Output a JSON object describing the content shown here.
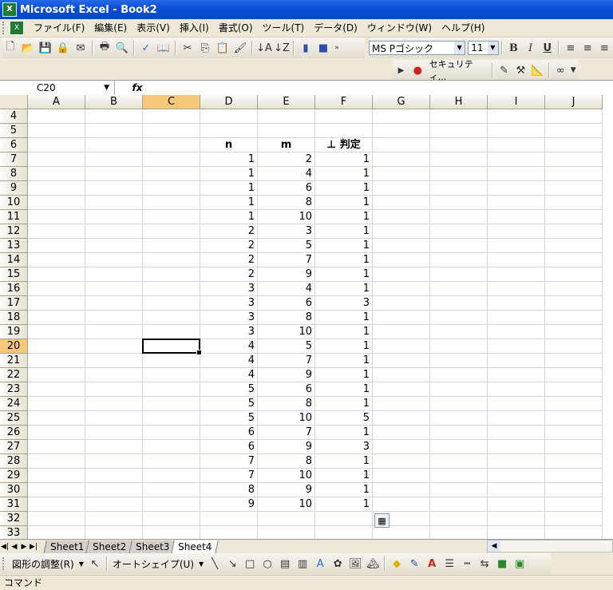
{
  "window": {
    "title": "Microsoft Excel - Book2"
  },
  "menu": [
    "ファイル(F)",
    "編集(E)",
    "表示(V)",
    "挿入(I)",
    "書式(O)",
    "ツール(T)",
    "データ(D)",
    "ウィンドウ(W)",
    "ヘルプ(H)"
  ],
  "format": {
    "font": "MS Pゴシック",
    "size": "11",
    "bold": "B",
    "italic": "I",
    "underline": "U"
  },
  "security": {
    "label": "セキュリティ..."
  },
  "formula": {
    "cell_ref": "C20",
    "fx": "fx",
    "content": ""
  },
  "columns": [
    "A",
    "B",
    "C",
    "D",
    "E",
    "F",
    "G",
    "H",
    "I",
    "J"
  ],
  "active": {
    "col": "C",
    "row": 20
  },
  "headers": {
    "n": "n",
    "m": "m",
    "f": "⊥ 判定"
  },
  "rows": [
    {
      "r": 4
    },
    {
      "r": 5
    },
    {
      "r": 6,
      "header": true
    },
    {
      "r": 7,
      "n": "1",
      "m": "2",
      "f": "1"
    },
    {
      "r": 8,
      "n": "1",
      "m": "4",
      "f": "1"
    },
    {
      "r": 9,
      "n": "1",
      "m": "6",
      "f": "1"
    },
    {
      "r": 10,
      "n": "1",
      "m": "8",
      "f": "1"
    },
    {
      "r": 11,
      "n": "1",
      "m": "10",
      "f": "1"
    },
    {
      "r": 12,
      "n": "2",
      "m": "3",
      "f": "1"
    },
    {
      "r": 13,
      "n": "2",
      "m": "5",
      "f": "1"
    },
    {
      "r": 14,
      "n": "2",
      "m": "7",
      "f": "1"
    },
    {
      "r": 15,
      "n": "2",
      "m": "9",
      "f": "1"
    },
    {
      "r": 16,
      "n": "3",
      "m": "4",
      "f": "1"
    },
    {
      "r": 17,
      "n": "3",
      "m": "6",
      "f": "3"
    },
    {
      "r": 18,
      "n": "3",
      "m": "8",
      "f": "1"
    },
    {
      "r": 19,
      "n": "3",
      "m": "10",
      "f": "1"
    },
    {
      "r": 20,
      "n": "4",
      "m": "5",
      "f": "1"
    },
    {
      "r": 21,
      "n": "4",
      "m": "7",
      "f": "1"
    },
    {
      "r": 22,
      "n": "4",
      "m": "9",
      "f": "1"
    },
    {
      "r": 23,
      "n": "5",
      "m": "6",
      "f": "1"
    },
    {
      "r": 24,
      "n": "5",
      "m": "8",
      "f": "1"
    },
    {
      "r": 25,
      "n": "5",
      "m": "10",
      "f": "5"
    },
    {
      "r": 26,
      "n": "6",
      "m": "7",
      "f": "1"
    },
    {
      "r": 27,
      "n": "6",
      "m": "9",
      "f": "3"
    },
    {
      "r": 28,
      "n": "7",
      "m": "8",
      "f": "1"
    },
    {
      "r": 29,
      "n": "7",
      "m": "10",
      "f": "1"
    },
    {
      "r": 30,
      "n": "8",
      "m": "9",
      "f": "1"
    },
    {
      "r": 31,
      "n": "9",
      "m": "10",
      "f": "1"
    },
    {
      "r": 32
    },
    {
      "r": 33
    }
  ],
  "sheets": [
    "Sheet1",
    "Sheet2",
    "Sheet3",
    "Sheet4"
  ],
  "active_sheet": "Sheet4",
  "drawing": {
    "draw_menu": "図形の調整(R)",
    "autoshape": "オートシェイプ(U)"
  },
  "status": {
    "text": "コマンド"
  }
}
